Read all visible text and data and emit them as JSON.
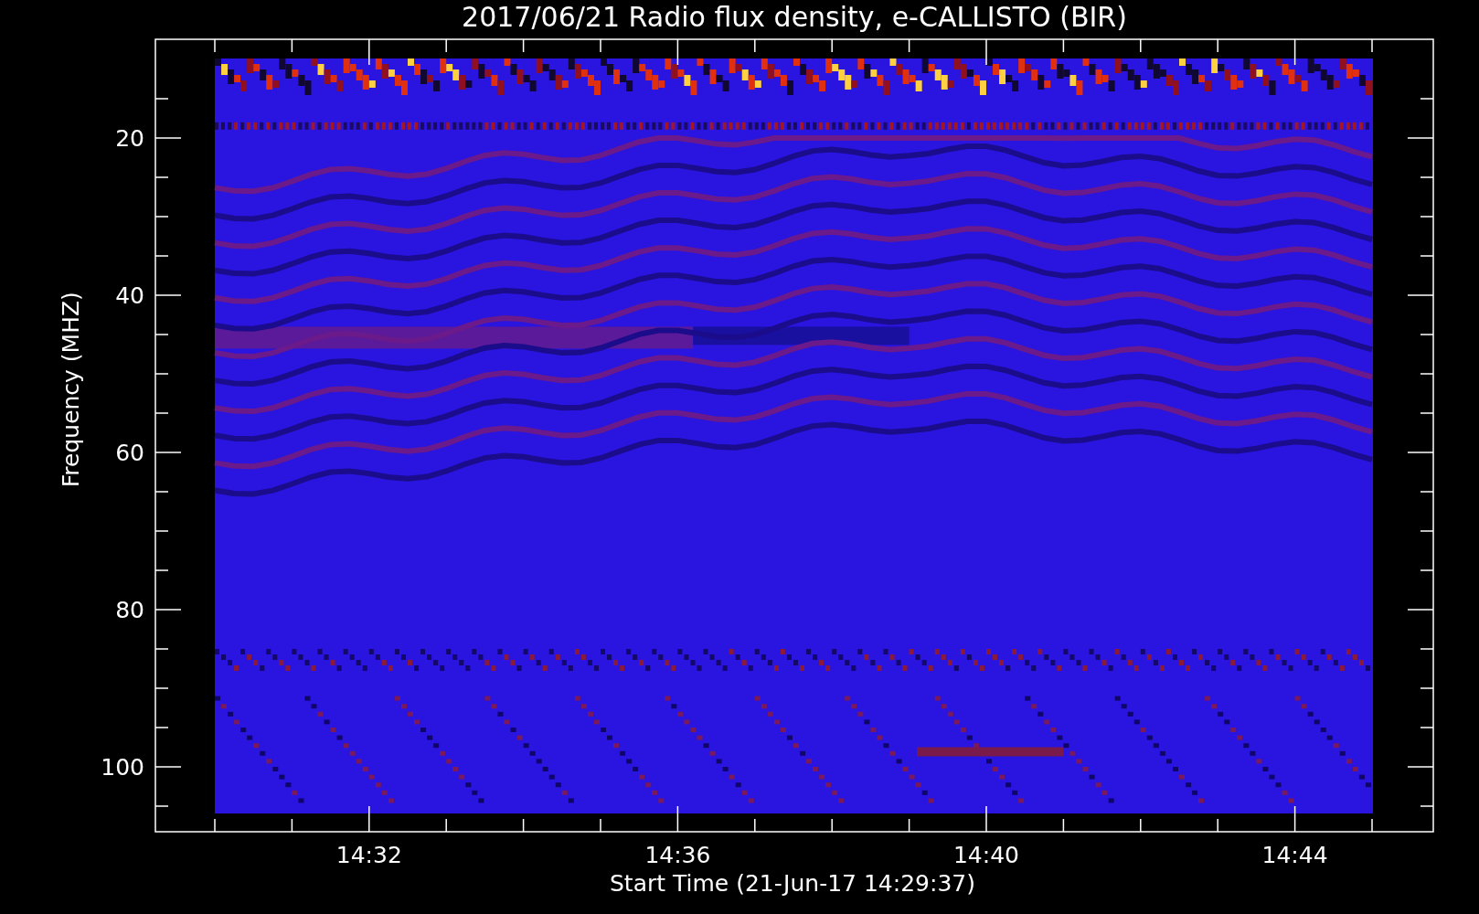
{
  "title": "2017/06/21  Radio flux density, e-CALLISTO (BIR)",
  "y_axis": {
    "label": "Frequency (MHZ)",
    "ticks": [
      "20",
      "40",
      "60",
      "80",
      "100"
    ]
  },
  "x_axis": {
    "label": "Start Time (21-Jun-17 14:29:37)",
    "ticks": [
      "14:32",
      "14:36",
      "14:40",
      "14:44"
    ]
  }
}
